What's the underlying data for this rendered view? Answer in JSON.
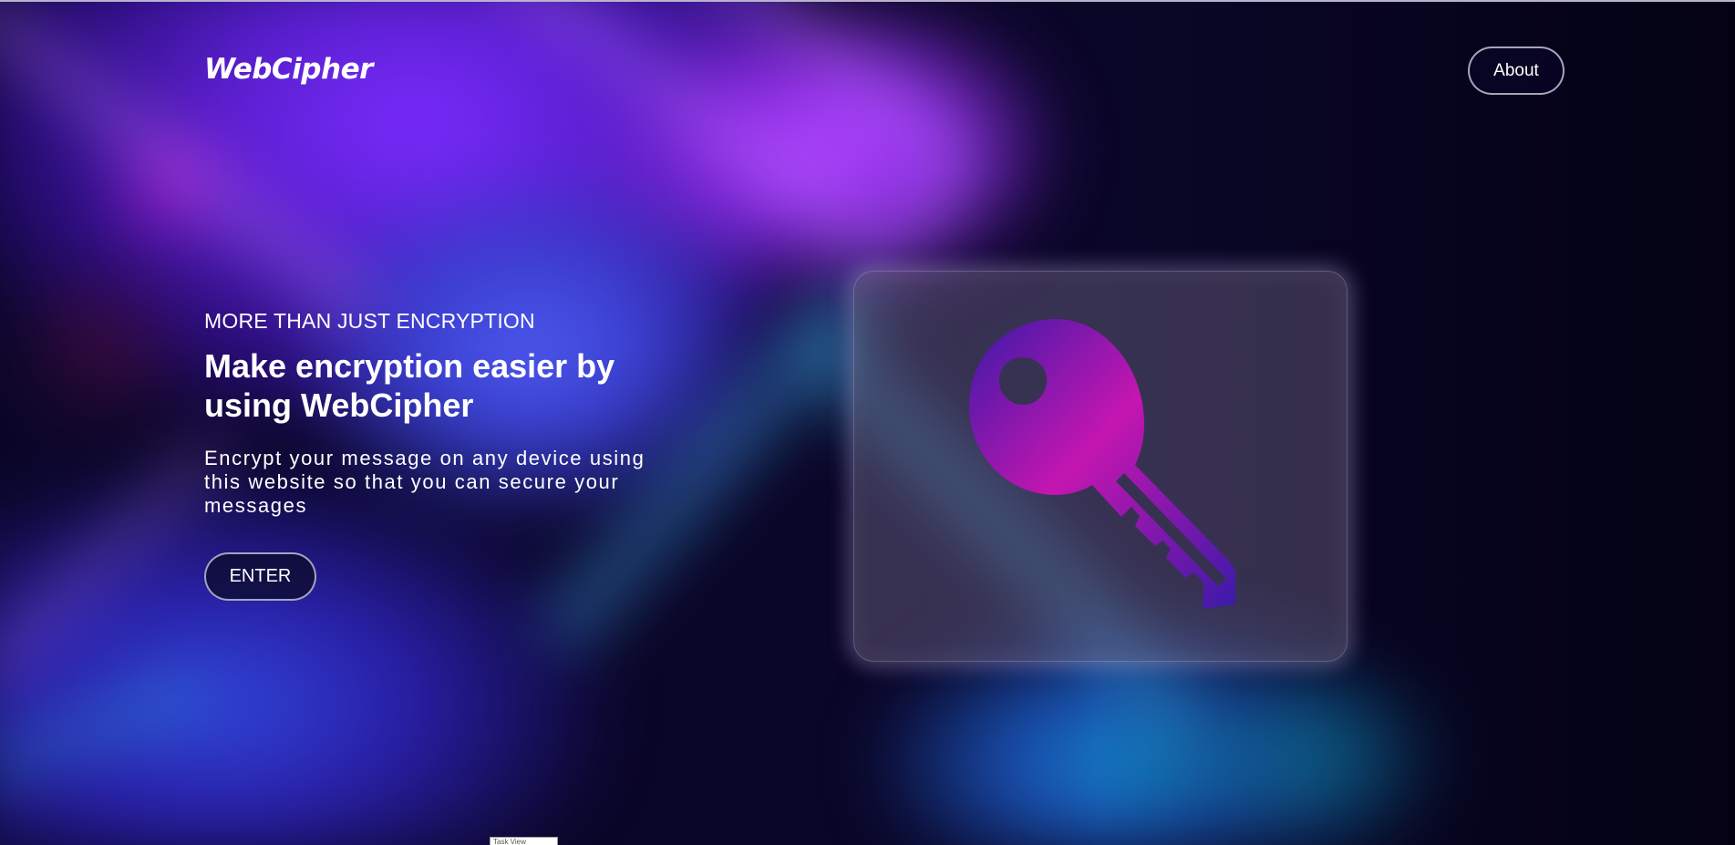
{
  "brand": {
    "logo_text": "WebCipher"
  },
  "nav": {
    "about_label": "About"
  },
  "hero": {
    "eyebrow": "MORE THAN JUST ENCRYPTION",
    "headline": "Make encryption easier by using WebCipher",
    "description": "Encrypt your message on any device using this website so that you can secure your messages",
    "cta_label": "ENTER"
  },
  "illustration": {
    "icon": "key-icon"
  },
  "footer_tag": {
    "text": "Task View"
  },
  "colors": {
    "text": "#ffffff",
    "key_gradient_start": "#3a1aa8",
    "key_gradient_mid": "#c416b0",
    "background_deep": "#0a0628"
  }
}
